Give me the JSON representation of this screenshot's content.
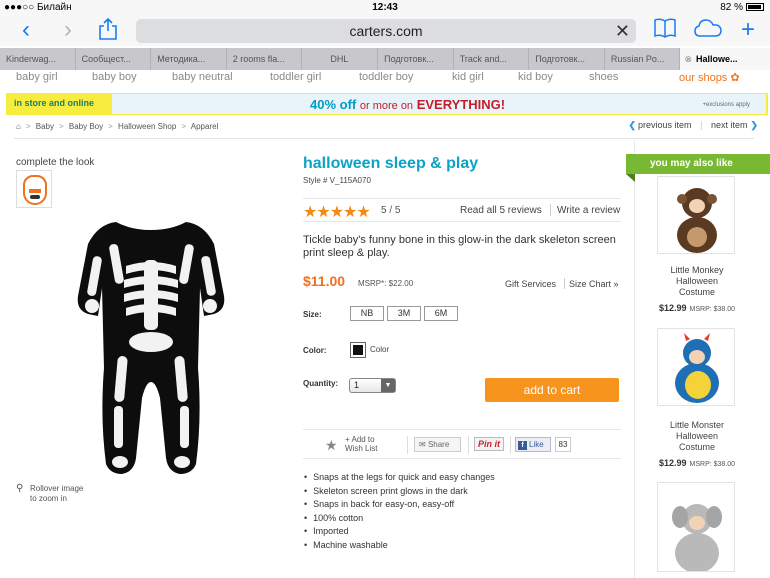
{
  "status": {
    "carrier": "Билайн",
    "time": "12:43",
    "battery": "82 %"
  },
  "browser": {
    "url": "carters.com",
    "tabs": [
      "Kinderwag...",
      "Сообщест...",
      "Методика...",
      "2 rooms fla...",
      "DHL",
      "Подготовк...",
      "Track and...",
      "Подготовк...",
      "Russian Po...",
      "Hallowe..."
    ]
  },
  "categories": [
    "baby girl",
    "baby boy",
    "baby neutral",
    "toddler girl",
    "toddler boy",
    "kid girl",
    "kid boy",
    "shoes",
    "our shops ✿"
  ],
  "promo": {
    "stores": "in store and online",
    "percent": "40% off",
    "middle": "or more on",
    "everything": "EVERYTHING!",
    "exclusions": "+exclusions apply"
  },
  "breadcrumb": [
    "Baby",
    "Baby Boy",
    "Halloween Shop",
    "Apparel"
  ],
  "pagenav": {
    "prev": "previous item",
    "next": "next item"
  },
  "left": {
    "complete_the_look": "complete the look",
    "rollover": "Rollover image",
    "to_zoom": "to zoom in"
  },
  "product": {
    "title": "halloween sleep & play",
    "style": "Style # V_115A070",
    "rating": "5 / 5",
    "rating_value": 5,
    "read_reviews": "Read all 5 reviews",
    "write_review": "Write a review",
    "description": "Tickle baby's funny bone in this glow-in the dark skeleton screen print sleep & play.",
    "price": "$11.00",
    "msrp": "MSRP*: $22.00",
    "gift_services": "Gift Services",
    "size_chart": "Size Chart »",
    "size_label": "Size:",
    "sizes": [
      "NB",
      "3M",
      "6M"
    ],
    "color_label": "Color:",
    "color_name": "Color",
    "swatch_color": "#111111",
    "quantity_label": "Quantity:",
    "quantity": "1",
    "add_to_cart": "add to cart",
    "add_to": "+ Add to",
    "wish_list": "Wish List",
    "share": "Share",
    "pinit": "Pin it",
    "like": "Like",
    "like_count": "83",
    "features": [
      "Snaps at the legs for quick and easy changes",
      "Skeleton screen print glows in the dark",
      "Snaps in back for easy-on, easy-off",
      "100% cotton",
      "Imported",
      "Machine washable"
    ]
  },
  "sidebar": {
    "heading": "you may also like",
    "items": [
      {
        "name_1": "Little Monkey",
        "name_2": "Halloween",
        "name_3": "Costume",
        "price": "$12.99",
        "msrp": "MSRP: $38.00"
      },
      {
        "name_1": "Little Monster",
        "name_2": "Halloween",
        "name_3": "Costume",
        "price": "$12.99",
        "msrp": "MSRP: $38.00"
      }
    ]
  },
  "colors": {
    "accent_blue": "#0aa3c7",
    "orange": "#f7941d",
    "green": "#79b832"
  }
}
